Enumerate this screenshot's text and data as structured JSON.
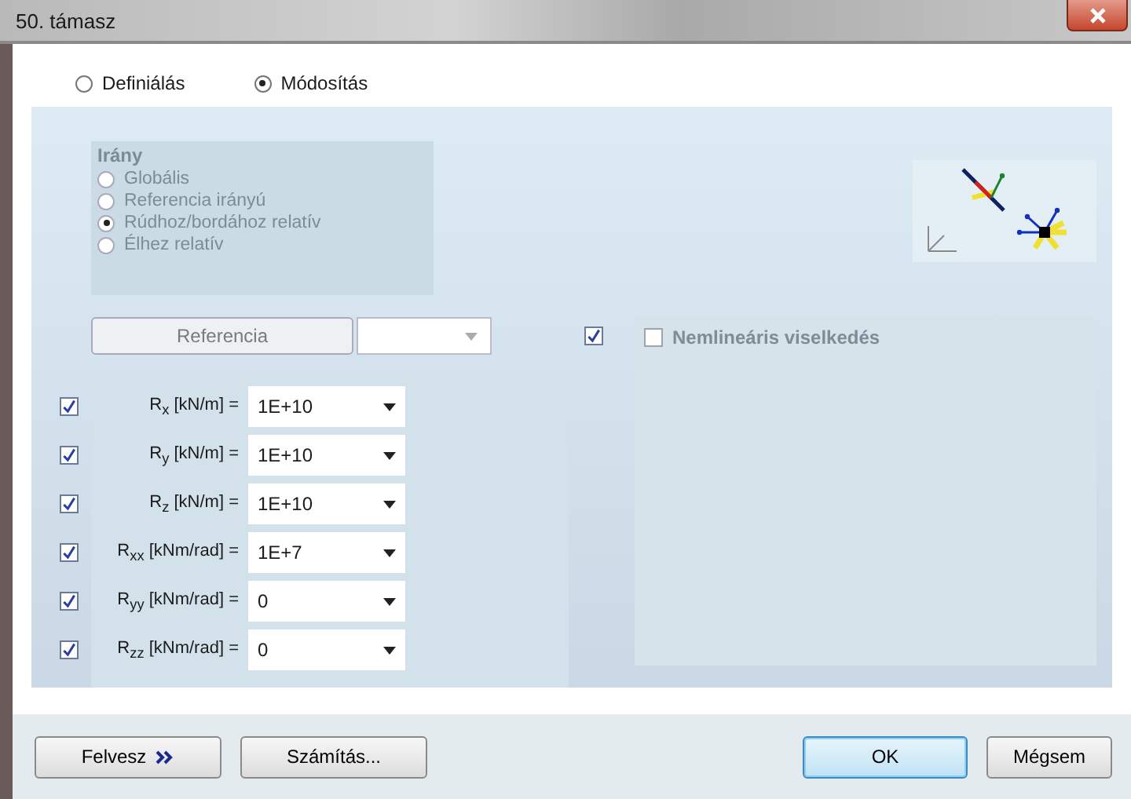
{
  "window": {
    "title": "50. támasz"
  },
  "mode_options": [
    {
      "label": "Definiálás",
      "selected": false
    },
    {
      "label": "Módosítás",
      "selected": true
    }
  ],
  "direction": {
    "title": "Irány",
    "disabled": true,
    "options": [
      {
        "label": "Globális",
        "selected": false
      },
      {
        "label": "Referencia irányú",
        "selected": false
      },
      {
        "label": "Rúdhoz/bordához relatív",
        "selected": true
      },
      {
        "label": "Élhez relatív",
        "selected": false
      }
    ]
  },
  "reference": {
    "button": "Referencia",
    "disabled": true
  },
  "stiffness_toggle": {
    "checked": true
  },
  "nonlinear": {
    "label": "Nemlineáris viselkedés",
    "checked": false,
    "disabled": true
  },
  "stiffness_rows": [
    {
      "label": "R$_{x}$ [kN/m] =",
      "value": "1E+10",
      "checked": true
    },
    {
      "label": "R$_{y}$ [kN/m] =",
      "value": "1E+10",
      "checked": true
    },
    {
      "label": "R$_{z}$ [kN/m] =",
      "value": "1E+10",
      "checked": true
    },
    {
      "label": "R$_{xx}$ [kNm/rad] =",
      "value": "1E+7",
      "checked": true
    },
    {
      "label": "R$_{yy}$ [kNm/rad] =",
      "value": "0",
      "checked": true
    },
    {
      "label": "R$_{zz}$ [kNm/rad] =",
      "value": "0",
      "checked": true
    }
  ],
  "footer": {
    "left": [
      {
        "label": "Felvesz",
        "kind": "more"
      },
      {
        "label": "Számítás...",
        "kind": "plain"
      }
    ],
    "right": [
      {
        "label": "OK",
        "kind": "default"
      },
      {
        "label": "Mégsem",
        "kind": "plain"
      }
    ]
  }
}
